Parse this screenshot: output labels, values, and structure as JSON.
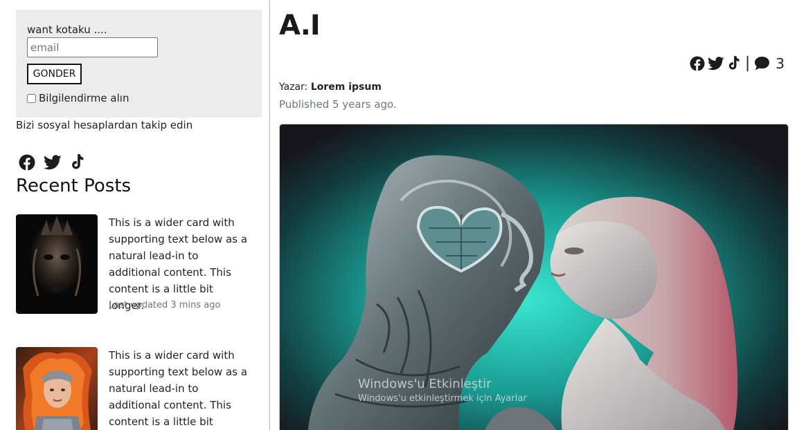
{
  "subscribe": {
    "title": "want kotaku ....",
    "email_placeholder": "email",
    "email_value": "",
    "send_label": "GONDER",
    "notify_label": "Bilgilendirme alın",
    "notify_checked": false
  },
  "sidebar": {
    "follow_text": "Bizi sosyal hesaplardan takip edin",
    "social_icons": [
      "facebook-icon",
      "twitter-icon",
      "tiktok-icon"
    ],
    "recent_title": "Recent Posts",
    "posts": [
      {
        "text": "This is a wider card with supporting text below as a natural lead-in to additional content. This content is a little bit longer.",
        "meta": "Last updated 3 mins ago",
        "thumb": "dark-demon-portrait"
      },
      {
        "text": "This is a wider card with supporting text below as a natural lead-in to additional content. This content is a little bit longer.",
        "meta": "",
        "thumb": "fire-warrior-woman"
      }
    ]
  },
  "article": {
    "title": "A.I",
    "share_icons": [
      "facebook-icon",
      "twitter-icon",
      "tiktok-icon"
    ],
    "separator": "|",
    "comment_count": "3",
    "author_label": "Yazar: ",
    "author_name": "Lorem ipsum",
    "published": "Published 5 years ago.",
    "image": "robot-and-woman-embrace"
  },
  "overlay": {
    "watermark_title": "Windows'u Etkinleştir",
    "watermark_sub": "Windows'u etkinleştirmek için Ayarlar'a gidin."
  },
  "colors": {
    "subscribe_bg": "#ececec",
    "muted": "#6c757d",
    "image_teal": "#2fd6c3"
  }
}
